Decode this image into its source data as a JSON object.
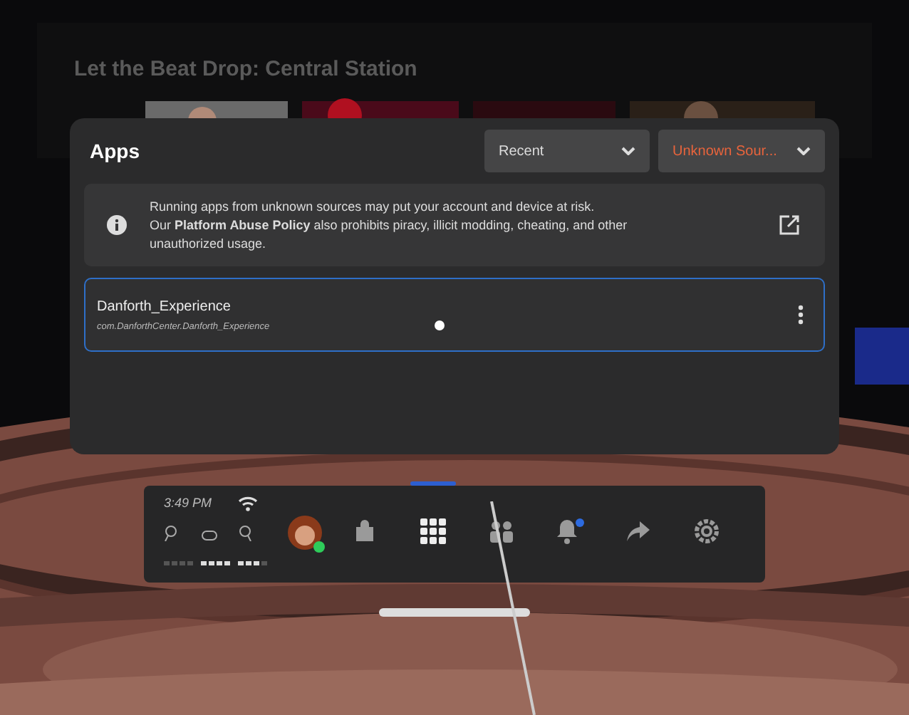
{
  "backdrop": {
    "title": "Let the Beat Drop: Central Station"
  },
  "apps_panel": {
    "title": "Apps",
    "filters": [
      {
        "label": "Recent",
        "highlighted": false
      },
      {
        "label": "Unknown Sour...",
        "highlighted": true
      }
    ],
    "notice": {
      "text": "Running apps from unknown sources may put your account and device at risk.\nOur **Platform Abuse Policy** also prohibits piracy, illicit modding, cheating, and other unauthorized usage."
    },
    "apps": [
      {
        "name": "Danforth_Experience",
        "package": "com.DanforthCenter.Danforth_Experience",
        "selected": true
      }
    ]
  },
  "dock": {
    "time": "3:49 PM",
    "avatar_online": true,
    "notification_badge": true,
    "items": [
      {
        "kind": "store",
        "selected": false
      },
      {
        "kind": "apps",
        "selected": true
      },
      {
        "kind": "people",
        "selected": false
      },
      {
        "kind": "notifications",
        "selected": false
      },
      {
        "kind": "share",
        "selected": false
      },
      {
        "kind": "settings",
        "selected": false
      }
    ]
  }
}
